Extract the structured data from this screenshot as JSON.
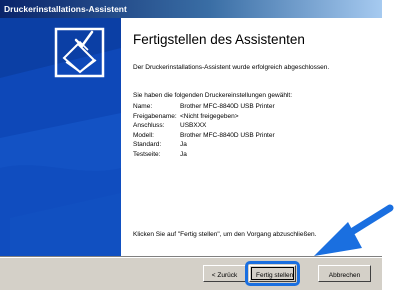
{
  "window": {
    "title": "Druckerinstallations-Assistent"
  },
  "main": {
    "heading": "Fertigstellen des Assistenten",
    "intro": "Der Druckerinstallations-Assistent wurde erfolgreich abgeschlossen.",
    "settings_intro": "Sie haben die folgenden Druckereinstellungen gewählt:",
    "settings": [
      {
        "label": "Name:",
        "value": "Brother MFC-8840D USB Printer"
      },
      {
        "label": "Freigabename:",
        "value": "<Nicht freigegeben>"
      },
      {
        "label": "Anschluss:",
        "value": "USBXXX"
      },
      {
        "label": "Modell:",
        "value": "Brother MFC-8840D USB Printer"
      },
      {
        "label": "Standard:",
        "value": "Ja"
      },
      {
        "label": "Testseite:",
        "value": "Ja"
      }
    ],
    "footer": "Klicken Sie auf \"Fertig stellen\", um den Vorgang abzuschließen."
  },
  "buttons": {
    "back": "< Zurück",
    "finish": "Fertig stellen",
    "cancel": "Abbrechen"
  },
  "icons": {
    "wizard": "printer-check-icon",
    "pointer": "arrow-pointer-icon"
  },
  "colors": {
    "titlebar": "#0a246a",
    "sidepanel": "#0b3fa5",
    "highlight": "#1a6fe0"
  }
}
